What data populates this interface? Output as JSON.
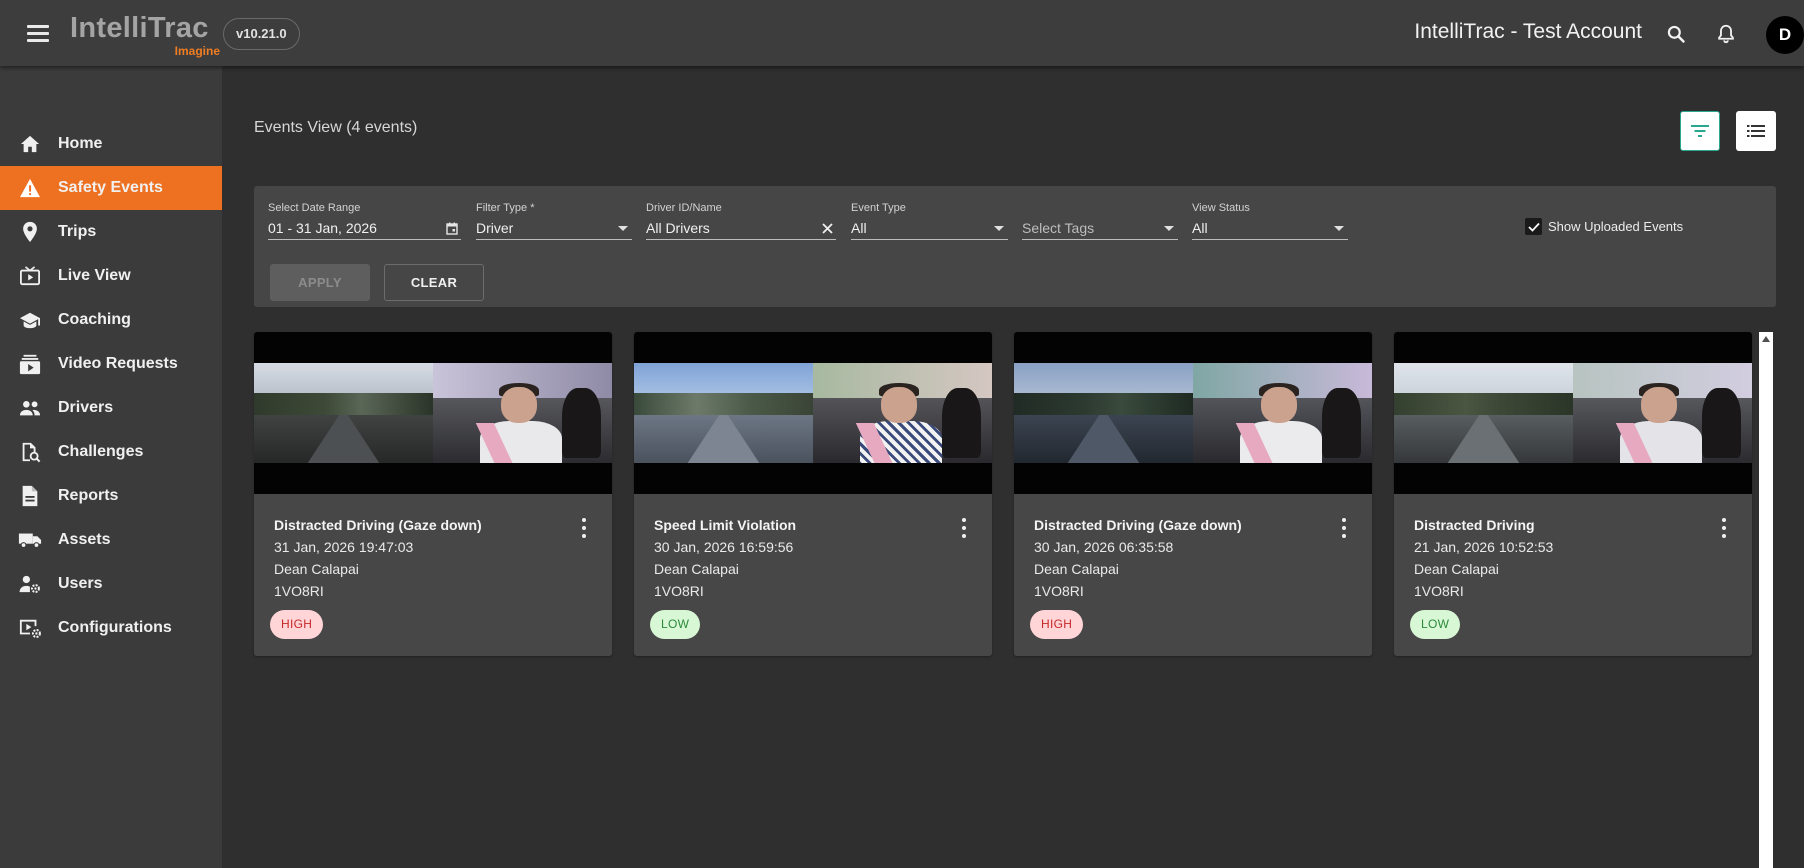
{
  "app": {
    "logo_main": "IntelliTrac",
    "logo_sub": "Imagine",
    "version": "v10.21.0",
    "account_title": "IntelliTrac - Test Account",
    "avatar_initial": "D"
  },
  "colors": {
    "accent": "#ee7121",
    "topbar": "#3d3d3d",
    "sidebar": "#3b3b3b",
    "background": "#2f2f2f",
    "card": "#474747",
    "filter_accent": "#2aa88f",
    "high_badge_bg": "#ffd5d8",
    "high_badge_text": "#c62828",
    "low_badge_bg": "#d7f7d5",
    "low_badge_text": "#2e8b3a"
  },
  "sidebar": {
    "items": [
      {
        "label": "Home",
        "icon": "home-icon",
        "active": false
      },
      {
        "label": "Safety Events",
        "icon": "warning-icon",
        "active": true
      },
      {
        "label": "Trips",
        "icon": "location-pin-icon",
        "active": false
      },
      {
        "label": "Live View",
        "icon": "live-tv-icon",
        "active": false
      },
      {
        "label": "Coaching",
        "icon": "graduation-cap-icon",
        "active": false
      },
      {
        "label": "Video Requests",
        "icon": "video-request-icon",
        "active": false
      },
      {
        "label": "Drivers",
        "icon": "people-icon",
        "active": false
      },
      {
        "label": "Challenges",
        "icon": "challenges-icon",
        "active": false
      },
      {
        "label": "Reports",
        "icon": "document-icon",
        "active": false
      },
      {
        "label": "Assets",
        "icon": "truck-icon",
        "active": false
      },
      {
        "label": "Users",
        "icon": "user-settings-icon",
        "active": false
      },
      {
        "label": "Configurations",
        "icon": "video-settings-icon",
        "active": false
      }
    ]
  },
  "page": {
    "title": "Events View (4 events)"
  },
  "filters": {
    "date_range": {
      "label": "Select Date Range",
      "value": "01 - 31 Jan, 2026"
    },
    "filter_type": {
      "label": "Filter Type *",
      "value": "Driver"
    },
    "driver": {
      "label": "Driver ID/Name",
      "value": "All Drivers"
    },
    "event_type": {
      "label": "Event Type",
      "value": "All"
    },
    "tags": {
      "placeholder": "Select Tags"
    },
    "view_status": {
      "label": "View Status",
      "value": "All"
    },
    "show_uploaded": {
      "label": "Show Uploaded Events",
      "checked": true
    },
    "apply_label": "APPLY",
    "clear_label": "CLEAR"
  },
  "events": [
    {
      "title": "Distracted Driving (Gaze down)",
      "datetime": "31 Jan, 2026 19:47:03",
      "driver": "Dean Calapai",
      "asset": "1VO8RI",
      "severity": "HIGH"
    },
    {
      "title": "Speed Limit Violation",
      "datetime": "30 Jan, 2026 16:59:56",
      "driver": "Dean Calapai",
      "asset": "1VO8RI",
      "severity": "LOW"
    },
    {
      "title": "Distracted Driving (Gaze down)",
      "datetime": "30 Jan, 2026 06:35:58",
      "driver": "Dean Calapai",
      "asset": "1VO8RI",
      "severity": "HIGH"
    },
    {
      "title": "Distracted Driving",
      "datetime": "21 Jan, 2026 10:52:53",
      "driver": "Dean Calapai",
      "asset": "1VO8RI",
      "severity": "LOW"
    }
  ]
}
